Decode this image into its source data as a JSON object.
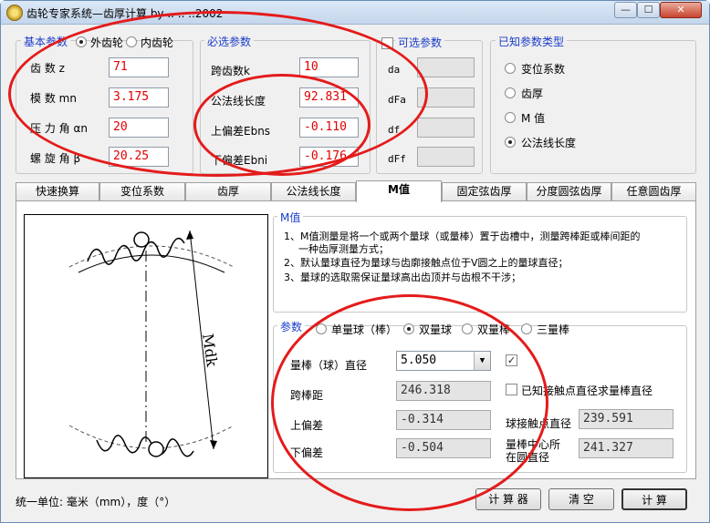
{
  "window": {
    "title": "齿轮专家系统—齿厚计算 by .. .. ..2002",
    "min_label": "—",
    "max_label": "☐",
    "close_label": "✕"
  },
  "basic": {
    "legend": "基本参数",
    "radio_external": "外齿轮",
    "radio_internal": "内齿轮",
    "teeth_label": "齿    数 z",
    "teeth_value": "71",
    "module_label": "模    数 mn",
    "module_value": "3.175",
    "pressure_label": "压 力 角 αn",
    "pressure_value": "20",
    "helix_label": "螺 旋 角 β",
    "helix_value": "20.25"
  },
  "required": {
    "legend": "必选参数",
    "span_label": "跨齿数k",
    "span_value": "10",
    "wlen_label": "公法线长度",
    "wlen_value": "92.831",
    "upper_label": "上偏差Ebns",
    "upper_value": "-0.110",
    "lower_label": "下偏差Ebni",
    "lower_value": "-0.176"
  },
  "optional": {
    "legend": "可选参数",
    "da_label": "da",
    "dfa_label": "dFa",
    "df_label": "df",
    "dff_label": "dFf"
  },
  "known": {
    "legend": "已知参数类型",
    "options": [
      "变位系数",
      "齿厚",
      "M 值",
      "公法线长度"
    ]
  },
  "tabs": [
    "快速换算",
    "变位系数",
    "齿厚",
    "公法线长度",
    "M值",
    "固定弦齿厚",
    "分度圆弦齿厚",
    "任意圆齿厚"
  ],
  "mvalue": {
    "legend": "M值",
    "line1": "1、M值测量是将一个或两个量球（或量棒）置于齿槽中，测量跨棒距或棒间距的",
    "line1b": "一种齿厚测量方式；",
    "line2": "2、默认量球直径为量球与齿廓接触点位于V圆之上的量球直径；",
    "line3": "3、量球的选取需保证量球高出齿顶并与齿根不干涉；",
    "figure_label": "Mdk"
  },
  "params": {
    "legend": "参数",
    "radio_single": "单量球（棒）",
    "radio_double_ball": "双量球",
    "radio_double_bar": "双量棒",
    "radio_three": "三量棒",
    "dia_label": "量棒（球）直径",
    "dia_value": "5.050",
    "span_label": "跨棒距",
    "span_value": "246.318",
    "upper_label": "上偏差",
    "upper_value": "-0.314",
    "lower_label": "下偏差",
    "lower_value": "-0.504",
    "known_chk_label": "已知接触点直径求量棒直径",
    "contact_label": "球接触点直径",
    "contact_value": "239.591",
    "center_label_1": "量棒中心所",
    "center_label_2": "在圆直径",
    "center_value": "241.327"
  },
  "footer": {
    "unit_text": "统一单位:  毫米（mm），度（°）",
    "calc_label": "计 算 器",
    "clear_label": "清   空",
    "compute_label": "计  算"
  },
  "colors": {
    "group_legend": "#1a3cc8",
    "input_text": "#e00000",
    "annotation": "#e41b1b"
  }
}
